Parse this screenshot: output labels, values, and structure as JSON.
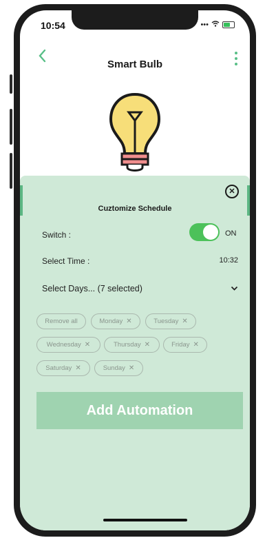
{
  "status_bar": {
    "time": "10:54"
  },
  "header": {
    "back_icon": "chevron-left-icon",
    "title": "Smart Bulb",
    "menu_icon": "more-vertical-icon"
  },
  "panel": {
    "close_icon": "close-circle-icon",
    "subtitle": "Cuztomize Schedule",
    "switch_label": "Switch :",
    "switch_state": "ON",
    "time_label": "Select Time :",
    "time_value": "10:32",
    "days_label": "Select Days... (7 selected)",
    "chips": {
      "remove_all": "Remove all",
      "monday": "Monday",
      "tuesday": "Tuesday",
      "wednesday": "Wednesday",
      "thursday": "Thursday",
      "friday": "Friday",
      "saturday": "Saturday",
      "sunday": "Sunday",
      "remove_glyph": "✕"
    },
    "add_button": "Add Automation"
  },
  "colors": {
    "accent": "#58bf87",
    "panel_bg": "#cfe9d7",
    "toggle_on": "#4cc15a",
    "button_bg": "#9fd3b0"
  }
}
